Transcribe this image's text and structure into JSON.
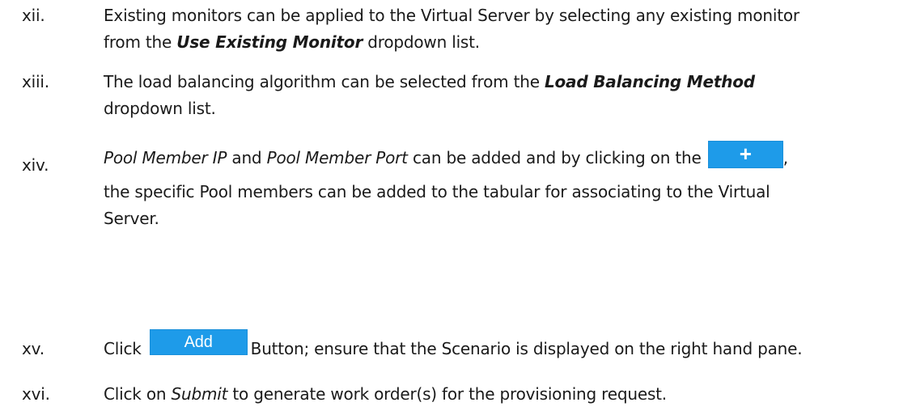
{
  "steps": [
    {
      "num": "xii.",
      "text_1": "Existing monitors can be applied to the Virtual Server by selecting any existing monitor",
      "text_2a": "from the ",
      "emph": "Use Existing Monitor",
      "text_2b": " dropdown list."
    },
    {
      "num": "xiii.",
      "text_1a": "The load balancing algorithm can be selected from the ",
      "emph": "Load Balancing Method",
      "text_2": "dropdown list."
    },
    {
      "num": "xiv.",
      "emph_1": "Pool Member IP",
      "text_1a": " and ",
      "emph_2": "Pool Member Port",
      "text_1b": " can be added and by clicking on the ",
      "plus_label": "+",
      "text_1c": ",",
      "text_2": "the specific Pool members can be added to the tabular for associating to the Virtual",
      "text_3": "Server."
    },
    {
      "num": "xv.",
      "text_a": "Click",
      "add_label": "Add",
      "text_b": "Button; ensure that the Scenario is displayed on the right hand pane."
    },
    {
      "num": "xvi.",
      "text_a": "Click on ",
      "emph": "Submit",
      "text_b": " to generate work order(s) for the provisioning request."
    }
  ],
  "colors": {
    "button_bg": "#1e9be9",
    "button_text": "#ffffff",
    "text": "#1a1a1a"
  }
}
